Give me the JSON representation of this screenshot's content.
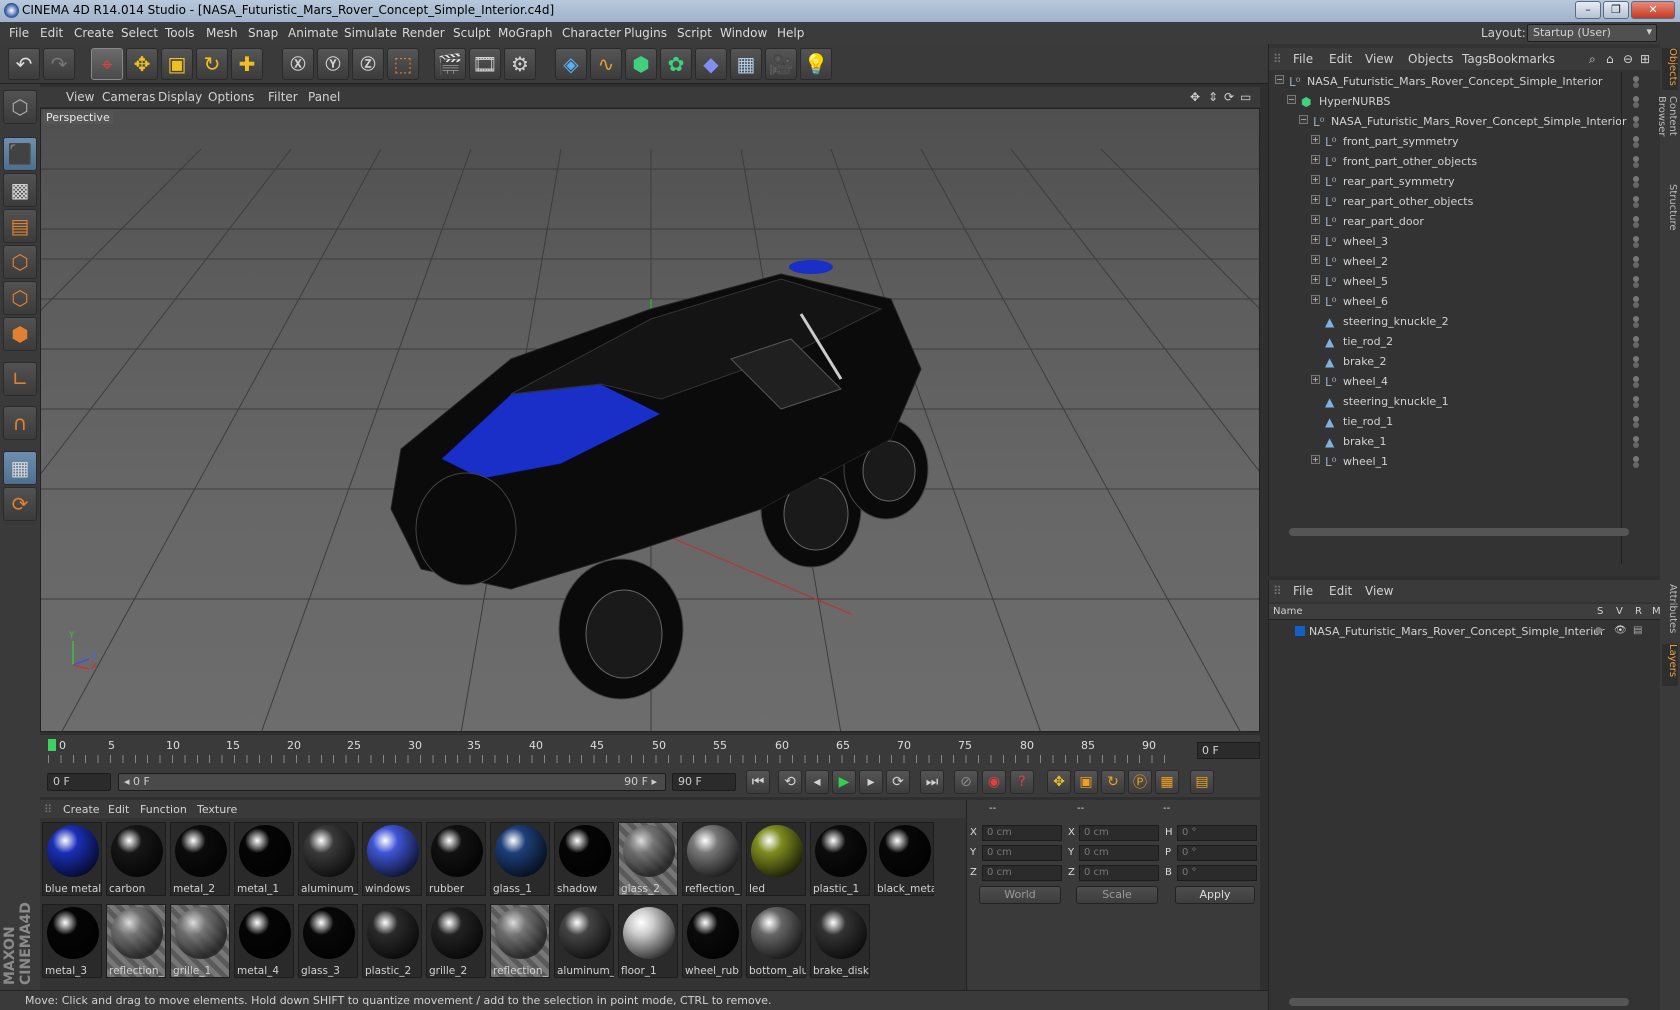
{
  "title": "CINEMA 4D R14.014 Studio - [NASA_Futuristic_Mars_Rover_Concept_Simple_Interior.c4d]",
  "window_buttons": [
    "–",
    "❐",
    "✕"
  ],
  "menu": [
    "File",
    "Edit",
    "Create",
    "Select",
    "Tools",
    "Mesh",
    "Snap",
    "Animate",
    "Simulate",
    "Render",
    "Sculpt",
    "MoGraph",
    "Character",
    "Plugins",
    "Script",
    "Window",
    "Help"
  ],
  "layout": {
    "label": "Layout:",
    "value": "Startup (User)"
  },
  "viewport": {
    "menu": [
      "View",
      "Cameras",
      "Display",
      "Options",
      "Filter",
      "Panel"
    ],
    "label": "Perspective",
    "axis": {
      "y": "Y",
      "z": "Z",
      "x": "X"
    }
  },
  "timeline": {
    "ticks": [
      "0",
      "5",
      "10",
      "15",
      "20",
      "25",
      "30",
      "35",
      "40",
      "45",
      "50",
      "55",
      "60",
      "65",
      "70",
      "75",
      "80",
      "85",
      "90"
    ],
    "current_frame": "0 F",
    "start_field": "0 F",
    "range_start": "◂ 0 F",
    "range_end": "90 F ▸",
    "end_field": "90 F"
  },
  "materials": {
    "menu": [
      "Create",
      "Edit",
      "Function",
      "Texture"
    ],
    "items": [
      {
        "label": "blue metal",
        "color": "#1a2fb8"
      },
      {
        "label": "carbon",
        "color": "#161616"
      },
      {
        "label": "metal_2",
        "color": "#0c0c0c"
      },
      {
        "label": "metal_1",
        "color": "#050505"
      },
      {
        "label": "aluminum_",
        "color": "#3a3a3a"
      },
      {
        "label": "windows",
        "color": "#3e55d6"
      },
      {
        "label": "rubber",
        "color": "#111111"
      },
      {
        "label": "glass_1",
        "color": "#1d3f7a"
      },
      {
        "label": "shadow",
        "color": "#050505"
      },
      {
        "label": "glass_2",
        "color": "checker"
      },
      {
        "label": "reflection_",
        "color": "#777777"
      },
      {
        "label": "led",
        "color": "#7f8c1e"
      },
      {
        "label": "plastic_1",
        "color": "#0c0c0c"
      },
      {
        "label": "black_meta",
        "color": "#070707"
      },
      {
        "label": "metal_3",
        "color": "#050505"
      },
      {
        "label": "reflection_",
        "color": "checker"
      },
      {
        "label": "grille_1",
        "color": "checker"
      },
      {
        "label": "metal_4",
        "color": "#050505"
      },
      {
        "label": "glass_3",
        "color": "#080808"
      },
      {
        "label": "plastic_2",
        "color": "#2a2a2a"
      },
      {
        "label": "grille_2",
        "color": "#222222"
      },
      {
        "label": "reflection_",
        "color": "checker"
      },
      {
        "label": "aluminum_",
        "color": "#444444"
      },
      {
        "label": "floor_1",
        "color": "#cccccc"
      },
      {
        "label": "wheel_rub",
        "color": "#0a0a0a"
      },
      {
        "label": "bottom_alu",
        "color": "#666666"
      },
      {
        "label": "brake_disk",
        "color": "#333333"
      }
    ]
  },
  "coords": {
    "headers": [
      "--",
      "--",
      "--"
    ],
    "rows": [
      {
        "a": "X",
        "av": "0 cm",
        "b": "X",
        "bv": "0 cm",
        "c": "H",
        "cv": "0 °"
      },
      {
        "a": "Y",
        "av": "0 cm",
        "b": "Y",
        "bv": "0 cm",
        "c": "P",
        "cv": "0 °"
      },
      {
        "a": "Z",
        "av": "0 cm",
        "b": "Z",
        "bv": "0 cm",
        "c": "B",
        "cv": "0 °"
      }
    ],
    "world": "World",
    "scale": "Scale",
    "apply": "Apply"
  },
  "status": "Move: Click and drag to move elements. Hold down SHIFT to quantize movement / add to the selection in point mode, CTRL to remove.",
  "objects": {
    "menu": [
      "File",
      "Edit",
      "View",
      "Objects",
      "Tags",
      "Bookmarks"
    ],
    "rows": [
      {
        "name": "NASA_Futuristic_Mars_Rover_Concept_Simple_Interior",
        "indent": 0,
        "icon": "null-icon",
        "expander": "−"
      },
      {
        "name": "HyperNURBS",
        "indent": 1,
        "icon": "hypernurbs-icon",
        "expander": "−"
      },
      {
        "name": "NASA_Futuristic_Mars_Rover_Concept_Simple_Interior",
        "indent": 2,
        "icon": "null-icon",
        "expander": "−"
      },
      {
        "name": "front_part_symmetry",
        "indent": 3,
        "icon": "null-icon",
        "expander": "+"
      },
      {
        "name": "front_part_other_objects",
        "indent": 3,
        "icon": "null-icon",
        "expander": "+"
      },
      {
        "name": "rear_part_symmetry",
        "indent": 3,
        "icon": "null-icon",
        "expander": "+"
      },
      {
        "name": "rear_part_other_objects",
        "indent": 3,
        "icon": "null-icon",
        "expander": "+"
      },
      {
        "name": "rear_part_door",
        "indent": 3,
        "icon": "null-icon",
        "expander": "+"
      },
      {
        "name": "wheel_3",
        "indent": 3,
        "icon": "null-icon",
        "expander": "+"
      },
      {
        "name": "wheel_2",
        "indent": 3,
        "icon": "null-icon",
        "expander": "+"
      },
      {
        "name": "wheel_5",
        "indent": 3,
        "icon": "null-icon",
        "expander": "+"
      },
      {
        "name": "wheel_6",
        "indent": 3,
        "icon": "null-icon",
        "expander": "+"
      },
      {
        "name": "steering_knuckle_2",
        "indent": 3,
        "icon": "polygon-icon",
        "expander": ""
      },
      {
        "name": "tie_rod_2",
        "indent": 3,
        "icon": "polygon-icon",
        "expander": ""
      },
      {
        "name": "brake_2",
        "indent": 3,
        "icon": "polygon-icon",
        "expander": ""
      },
      {
        "name": "wheel_4",
        "indent": 3,
        "icon": "null-icon",
        "expander": "+"
      },
      {
        "name": "steering_knuckle_1",
        "indent": 3,
        "icon": "polygon-icon",
        "expander": ""
      },
      {
        "name": "tie_rod_1",
        "indent": 3,
        "icon": "polygon-icon",
        "expander": ""
      },
      {
        "name": "brake_1",
        "indent": 3,
        "icon": "polygon-icon",
        "expander": ""
      },
      {
        "name": "wheel_1",
        "indent": 3,
        "icon": "null-icon",
        "expander": "+"
      }
    ]
  },
  "layers": {
    "menu": [
      "File",
      "Edit",
      "View"
    ],
    "columns": {
      "name": "Name",
      "s": "S",
      "v": "V",
      "r": "R",
      "m": "M"
    },
    "rows": [
      {
        "name": "NASA_Futuristic_Mars_Rover_Concept_Simple_Interior",
        "color": "#1560c8"
      }
    ]
  },
  "side_tabs": [
    "Objects",
    "Content Browser",
    "Structure",
    "Attributes",
    "Layers"
  ]
}
